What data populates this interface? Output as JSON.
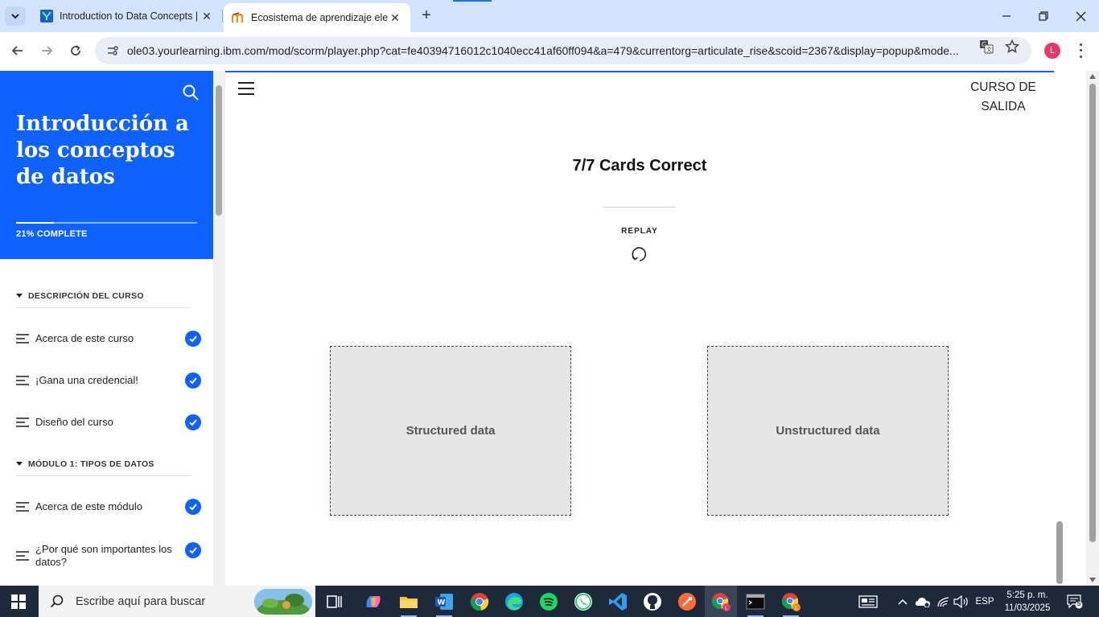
{
  "browser": {
    "tabs": [
      {
        "title": "Introduction to Data Concepts | Y",
        "active": false
      },
      {
        "title": "Ecosistema de aprendizaje elect",
        "active": true
      }
    ],
    "url": "ole03.yourlearning.ibm.com/mod/scorm/player.php?cat=fe40394716012c1040ecc41af60ff094&a=479&currentorg=articulate_rise&scoid=2367&display=popup&mode...",
    "profile_initial": "L"
  },
  "sidebar": {
    "course_title": "Introducción a los conceptos de datos",
    "progress_percent": 21,
    "progress_label": "21% COMPLETE",
    "sections": [
      {
        "label": "DESCRIPCIÓN DEL CURSO"
      },
      {
        "label": "MÓDULO 1: TIPOS DE DATOS"
      }
    ],
    "items": [
      {
        "label": "Acerca de este curso",
        "completed": true
      },
      {
        "label": "¡Gana una credencial!",
        "completed": true
      },
      {
        "label": "Diseño del curso",
        "completed": true
      },
      {
        "label": "Acerca de este módulo",
        "completed": true
      },
      {
        "label": "¿Por qué son importantes los datos?",
        "completed": true
      }
    ]
  },
  "main": {
    "exit_label": "CURSO DE SALIDA",
    "result_title": "7/7 Cards Correct",
    "replay_label": "REPLAY",
    "cards": [
      {
        "label": "Structured data"
      },
      {
        "label": "Unstructured data"
      }
    ]
  },
  "taskbar": {
    "search_placeholder": "Escribe aquí para buscar",
    "language": "ESP",
    "time": "5:25 p. m.",
    "date": "11/03/2025",
    "notification_count": "5"
  },
  "colors": {
    "brand_blue": "#0f62fe",
    "tab_strip": "#d3e3fd",
    "taskbar": "#1e2a3a"
  }
}
